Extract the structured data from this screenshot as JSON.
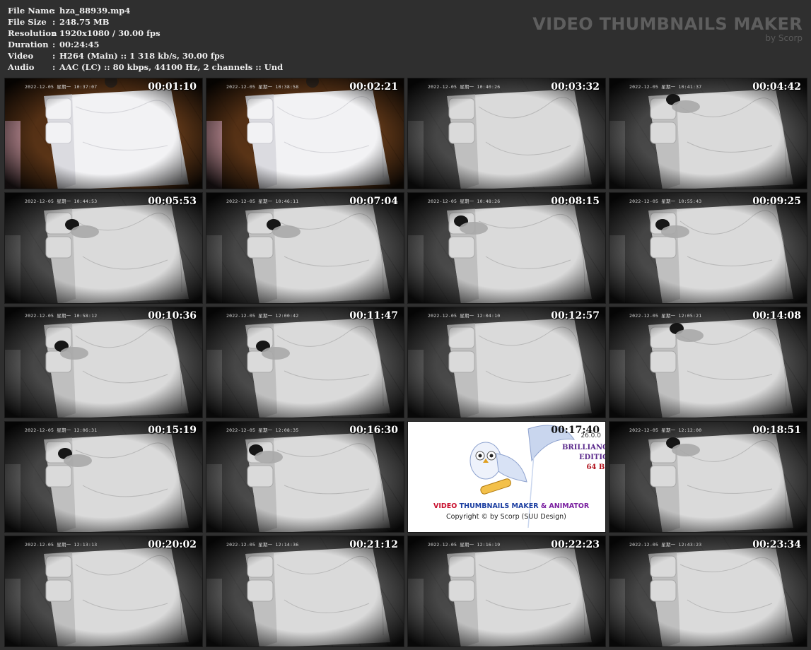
{
  "meta": [
    {
      "key": "File Name",
      "value": "hza_88939.mp4"
    },
    {
      "key": "File Size",
      "value": "248.75 MB"
    },
    {
      "key": "Resolution",
      "value": "1920x1080 / 30.00 fps"
    },
    {
      "key": "Duration",
      "value": "00:24:45"
    },
    {
      "key": "Video",
      "value": "H264 (Main) :: 1 318 kb/s, 30.00 fps"
    },
    {
      "key": "Audio",
      "value": "AAC (LC) :: 80 kbps, 44100 Hz, 2 channels :: Und"
    }
  ],
  "meta_separator": ":",
  "brand": {
    "title": "VIDEO THUMBNAILS MAKER",
    "subtitle": "by Scorp"
  },
  "thumbnails": [
    {
      "time": "00:01:10",
      "osd": "2022-12-05 星期一 10:37:07",
      "tone": "color"
    },
    {
      "time": "00:02:21",
      "osd": "2022-12-05 星期一 10:38:58",
      "tone": "color"
    },
    {
      "time": "00:03:32",
      "osd": "2022-12-05 星期一 10:40:26",
      "tone": "gray"
    },
    {
      "time": "00:04:42",
      "osd": "2022-12-05 星期一 10:41:37",
      "tone": "gray"
    },
    {
      "time": "00:05:53",
      "osd": "2022-12-05 星期一 10:44:53",
      "tone": "gray"
    },
    {
      "time": "00:07:04",
      "osd": "2022-12-05 星期一 10:46:11",
      "tone": "gray"
    },
    {
      "time": "00:08:15",
      "osd": "2022-12-05 星期一 10:48:26",
      "tone": "gray"
    },
    {
      "time": "00:09:25",
      "osd": "2022-12-05 星期一 10:55:43",
      "tone": "gray"
    },
    {
      "time": "00:10:36",
      "osd": "2022-12-05 星期一 10:58:12",
      "tone": "gray"
    },
    {
      "time": "00:11:47",
      "osd": "2022-12-05 星期一 12:00:42",
      "tone": "gray"
    },
    {
      "time": "00:12:57",
      "osd": "2022-12-05 星期一 12:04:10",
      "tone": "gray"
    },
    {
      "time": "00:14:08",
      "osd": "2022-12-05 星期一 12:05:21",
      "tone": "gray"
    },
    {
      "time": "00:15:19",
      "osd": "2022-12-05 星期一 12:06:31",
      "tone": "gray"
    },
    {
      "time": "00:16:30",
      "osd": "2022-12-05 星期一 12:08:35",
      "tone": "gray"
    },
    {
      "time": "00:17:40",
      "osd": "",
      "tone": "promo"
    },
    {
      "time": "00:18:51",
      "osd": "2022-12-05 星期一 12:12:00",
      "tone": "gray"
    },
    {
      "time": "00:20:02",
      "osd": "2022-12-05 星期一 12:13:13",
      "tone": "gray"
    },
    {
      "time": "00:21:12",
      "osd": "2022-12-05 星期一 12:14:36",
      "tone": "gray"
    },
    {
      "time": "00:22:23",
      "osd": "2022-12-05 星期一 12:16:19",
      "tone": "gray"
    },
    {
      "time": "00:23:34",
      "osd": "2022-12-05 星期一 12:43:23",
      "tone": "gray"
    }
  ],
  "promo": {
    "line1_a": "VIDEO ",
    "line1_b": "THUMBNAILS MAKER ",
    "line1_c": "& ANIMATOR",
    "line2": "Copyright © by Scorp (SUU Design)",
    "version": "26.0.0",
    "edition1": "BRILLIANC",
    "edition2": "EDITIC",
    "edition3": "64 BI"
  },
  "colors": {
    "background": "#2f2f2f",
    "header_text": "#eeeeee",
    "brand_text": "#5e5e5e"
  }
}
